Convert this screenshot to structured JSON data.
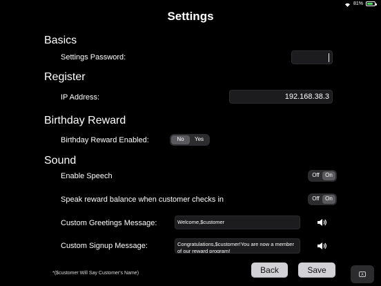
{
  "status": {
    "battery": "81%",
    "battery_level": 0.81
  },
  "header": {
    "title": "Settings"
  },
  "basics": {
    "heading": "Basics",
    "password_label": "Settings Password:",
    "password_value": ""
  },
  "register": {
    "heading": "Register",
    "ip_label": "IP Address:",
    "ip_value": "192.168.38.3"
  },
  "birthday": {
    "heading": "Birthday Reward",
    "enabled_label": "Birthday Reward Enabled:",
    "options": [
      "No",
      "Yes"
    ],
    "selected": "No"
  },
  "sound": {
    "heading": "Sound",
    "enable_speech_label": "Enable Speech",
    "enable_speech_options": [
      "Off",
      "On"
    ],
    "enable_speech_selected": "On",
    "speak_balance_label": "Speak reward balance when customer checks in",
    "speak_balance_options": [
      "Off",
      "On"
    ],
    "speak_balance_selected": "On",
    "greeting_label": "Custom Greetings Message:",
    "greeting_value": "Welcome,$customer",
    "signup_label": "Custom Signup Message:",
    "signup_value": "Congratulations,$customer!You are now a member of our reward program!"
  },
  "footer": {
    "note": "*($customer Will Say Customer's Name)",
    "back_label": "Back",
    "save_label": "Save",
    "keyboard_label": "A"
  }
}
